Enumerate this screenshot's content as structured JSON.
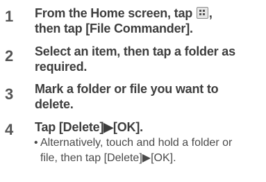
{
  "steps": [
    {
      "number": "1",
      "line1_part1": "From the Home screen, tap",
      "line1_part2": ",",
      "line2": "then tap [File Commander]."
    },
    {
      "number": "2",
      "line1": "Select an item, then tap a folder as",
      "line2": "required."
    },
    {
      "number": "3",
      "line1": "Mark a folder or file you want to",
      "line2": "delete."
    },
    {
      "number": "4",
      "line1": "Tap [Delete]▶[OK].",
      "note_bullet": "•",
      "note_line1": "Alternatively, touch and hold a folder or",
      "note_line2": "file, then tap [Delete]▶[OK]."
    }
  ],
  "icons": {
    "apps": "apps-grid-icon"
  }
}
